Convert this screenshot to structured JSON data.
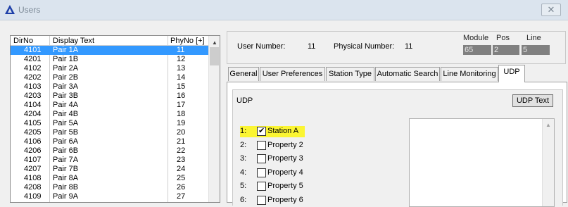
{
  "window": {
    "title": "Users",
    "close_glyph": "✕"
  },
  "list": {
    "headers": {
      "dirno": "DirNo",
      "display": "Display Text",
      "phyno": "PhyNo [+]"
    },
    "rows": [
      {
        "dirno": "4101",
        "display": "Pair 1A",
        "phyno": "11",
        "selected": true
      },
      {
        "dirno": "4201",
        "display": "Pair 1B",
        "phyno": "12"
      },
      {
        "dirno": "4102",
        "display": "Pair 2A",
        "phyno": "13"
      },
      {
        "dirno": "4202",
        "display": "Pair 2B",
        "phyno": "14"
      },
      {
        "dirno": "4103",
        "display": "Pair 3A",
        "phyno": "15"
      },
      {
        "dirno": "4203",
        "display": "Pair 3B",
        "phyno": "16"
      },
      {
        "dirno": "4104",
        "display": "Pair 4A",
        "phyno": "17"
      },
      {
        "dirno": "4204",
        "display": "Pair 4B",
        "phyno": "18"
      },
      {
        "dirno": "4105",
        "display": "Pair 5A",
        "phyno": "19"
      },
      {
        "dirno": "4205",
        "display": "Pair 5B",
        "phyno": "20"
      },
      {
        "dirno": "4106",
        "display": "Pair 6A",
        "phyno": "21"
      },
      {
        "dirno": "4206",
        "display": "Pair 6B",
        "phyno": "22"
      },
      {
        "dirno": "4107",
        "display": "Pair 7A",
        "phyno": "23"
      },
      {
        "dirno": "4207",
        "display": "Pair 7B",
        "phyno": "24"
      },
      {
        "dirno": "4108",
        "display": "Pair 8A",
        "phyno": "25"
      },
      {
        "dirno": "4208",
        "display": "Pair 8B",
        "phyno": "26"
      },
      {
        "dirno": "4109",
        "display": "Pair 9A",
        "phyno": "27"
      }
    ]
  },
  "info": {
    "user_number_label": "User Number:",
    "user_number": "11",
    "physical_number_label": "Physical Number:",
    "physical_number": "11",
    "module_label": "Module",
    "module": "65",
    "pos_label": "Pos",
    "pos": "2",
    "line_label": "Line",
    "line": "5"
  },
  "tabs": [
    "General",
    "User Preferences",
    "Station Type",
    "Automatic Search",
    "Line Monitoring",
    "UDP"
  ],
  "active_tab": "UDP",
  "udp": {
    "title": "UDP",
    "udp_text_button": "UDP Text",
    "properties": [
      {
        "num": "1:",
        "label": "Station A",
        "checked": true,
        "highlight": true
      },
      {
        "num": "2:",
        "label": "Property 2",
        "checked": false
      },
      {
        "num": "3:",
        "label": "Property 3",
        "checked": false
      },
      {
        "num": "4:",
        "label": "Property 4",
        "checked": false
      },
      {
        "num": "5:",
        "label": "Property 5",
        "checked": false
      },
      {
        "num": "6:",
        "label": "Property 6",
        "checked": false
      }
    ]
  },
  "colors": {
    "selection": "#3399ff",
    "highlight": "#fbf532",
    "value_box": "#808080"
  },
  "icons": {
    "app": "triangle-app-icon",
    "close": "close-icon",
    "scroll_up": "chevron-up-icon",
    "check": "checkmark-icon"
  }
}
